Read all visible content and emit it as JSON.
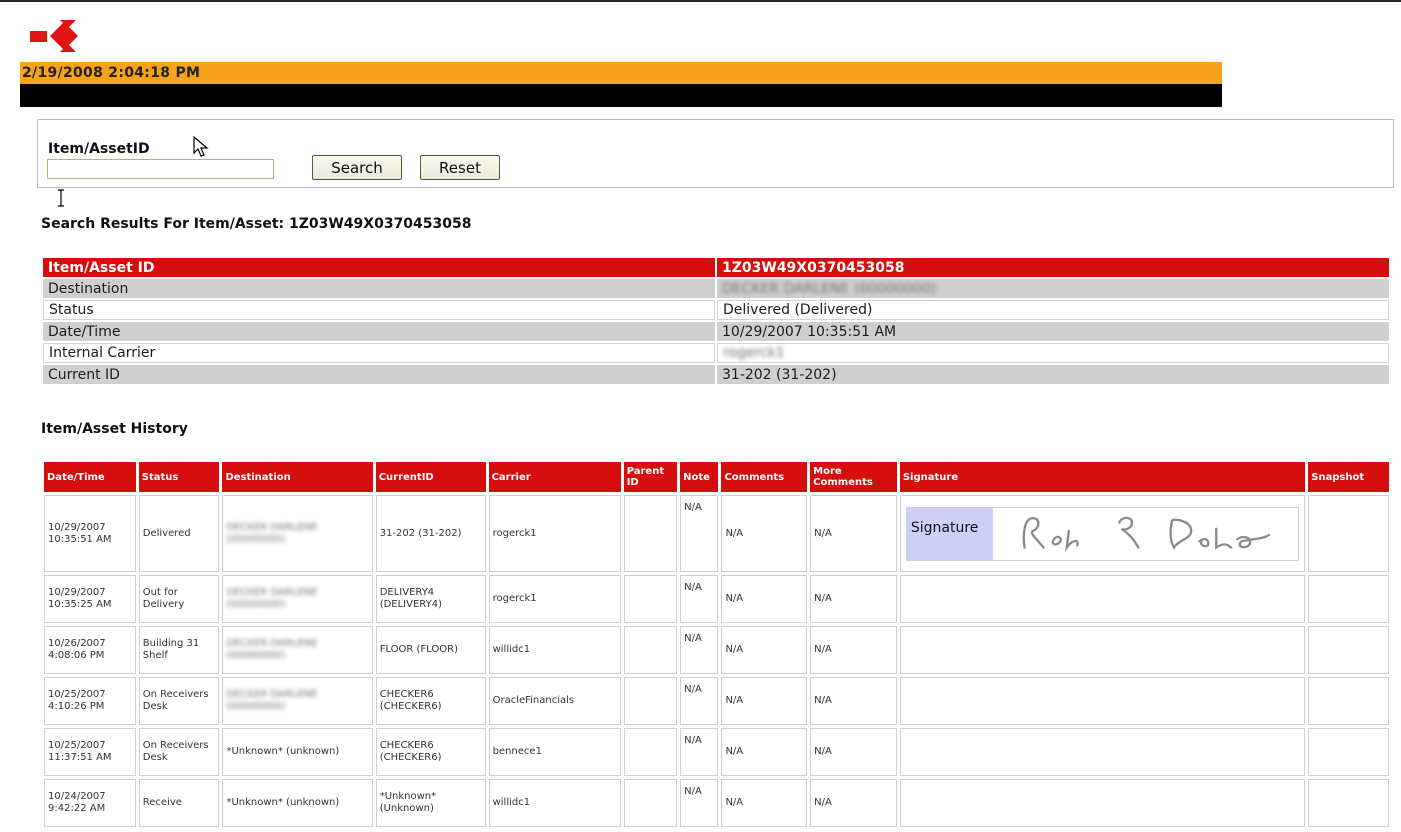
{
  "header": {
    "logo_icon": "red-geometric-logo",
    "timestamp": "2/19/2008 2:04:18 PM",
    "accent_color": "#f7a21b",
    "brand_color": "#d50d0d"
  },
  "search": {
    "label": "Item/AssetID",
    "input_value": "",
    "search_button": "Search",
    "reset_button": "Reset"
  },
  "results": {
    "title": "Search Results For Item/Asset: 1Z03W49X0370453058",
    "rows": [
      {
        "label": "Item/Asset ID",
        "value": "1Z03W49X0370453058"
      },
      {
        "label": "Destination",
        "value": "DECKER DARLENE (00000000)"
      },
      {
        "label": "Status",
        "value": "Delivered (Delivered)"
      },
      {
        "label": "Date/Time",
        "value": "10/29/2007 10:35:51 AM"
      },
      {
        "label": "Internal Carrier",
        "value": "rogerck1"
      },
      {
        "label": "Current ID",
        "value": "31-202 (31-202)"
      }
    ]
  },
  "history": {
    "title": "Item/Asset History",
    "columns": [
      "Date/Time",
      "Status",
      "Destination",
      "CurrentID",
      "Carrier",
      "Parent ID",
      "Note",
      "Comments",
      "More Comments",
      "Signature",
      "Snapshot"
    ],
    "rows": [
      {
        "datetime": "10/29/2007 10:35:51 AM",
        "status": "Delivered",
        "destination": "DECKER DARLENE (00000000)",
        "current_id": "31-202 (31-202)",
        "carrier": "rogerck1",
        "parent_id": "",
        "note": "N/A",
        "comments": "N/A",
        "more_comments": "N/A",
        "signature_label": "Signature",
        "signature_text": "Rob R. Rude",
        "snapshot": ""
      },
      {
        "datetime": "10/29/2007 10:35:25 AM",
        "status": "Out for Delivery",
        "destination": "DECKER DARLENE (00000000)",
        "current_id": "DELIVERY4 (DELIVERY4)",
        "carrier": "rogerck1",
        "parent_id": "",
        "note": "N/A",
        "comments": "N/A",
        "more_comments": "N/A",
        "snapshot": ""
      },
      {
        "datetime": "10/26/2007 4:08:06 PM",
        "status": "Building 31 Shelf",
        "destination": "DECKER DARLENE (00000000)",
        "current_id": "FLOOR (FLOOR)",
        "carrier": "willidc1",
        "parent_id": "",
        "note": "N/A",
        "comments": "N/A",
        "more_comments": "N/A",
        "snapshot": ""
      },
      {
        "datetime": "10/25/2007 4:10:26 PM",
        "status": "On Receivers Desk",
        "destination": "DECKER DARLENE (00000000)",
        "current_id": "CHECKER6 (CHECKER6)",
        "carrier": "OracleFinancials",
        "parent_id": "",
        "note": "N/A",
        "comments": "N/A",
        "more_comments": "N/A",
        "snapshot": ""
      },
      {
        "datetime": "10/25/2007 11:37:51 AM",
        "status": "On Receivers Desk",
        "destination": "*Unknown* (unknown)",
        "current_id": "CHECKER6 (CHECKER6)",
        "carrier": "bennece1",
        "parent_id": "",
        "note": "N/A",
        "comments": "N/A",
        "more_comments": "N/A",
        "snapshot": ""
      },
      {
        "datetime": "10/24/2007 9:42:22 AM",
        "status": "Receive",
        "destination": "*Unknown* (unknown)",
        "current_id": "*Unknown* (Unknown)",
        "carrier": "willidc1",
        "parent_id": "",
        "note": "N/A",
        "comments": "N/A",
        "more_comments": "N/A",
        "snapshot": ""
      }
    ]
  }
}
